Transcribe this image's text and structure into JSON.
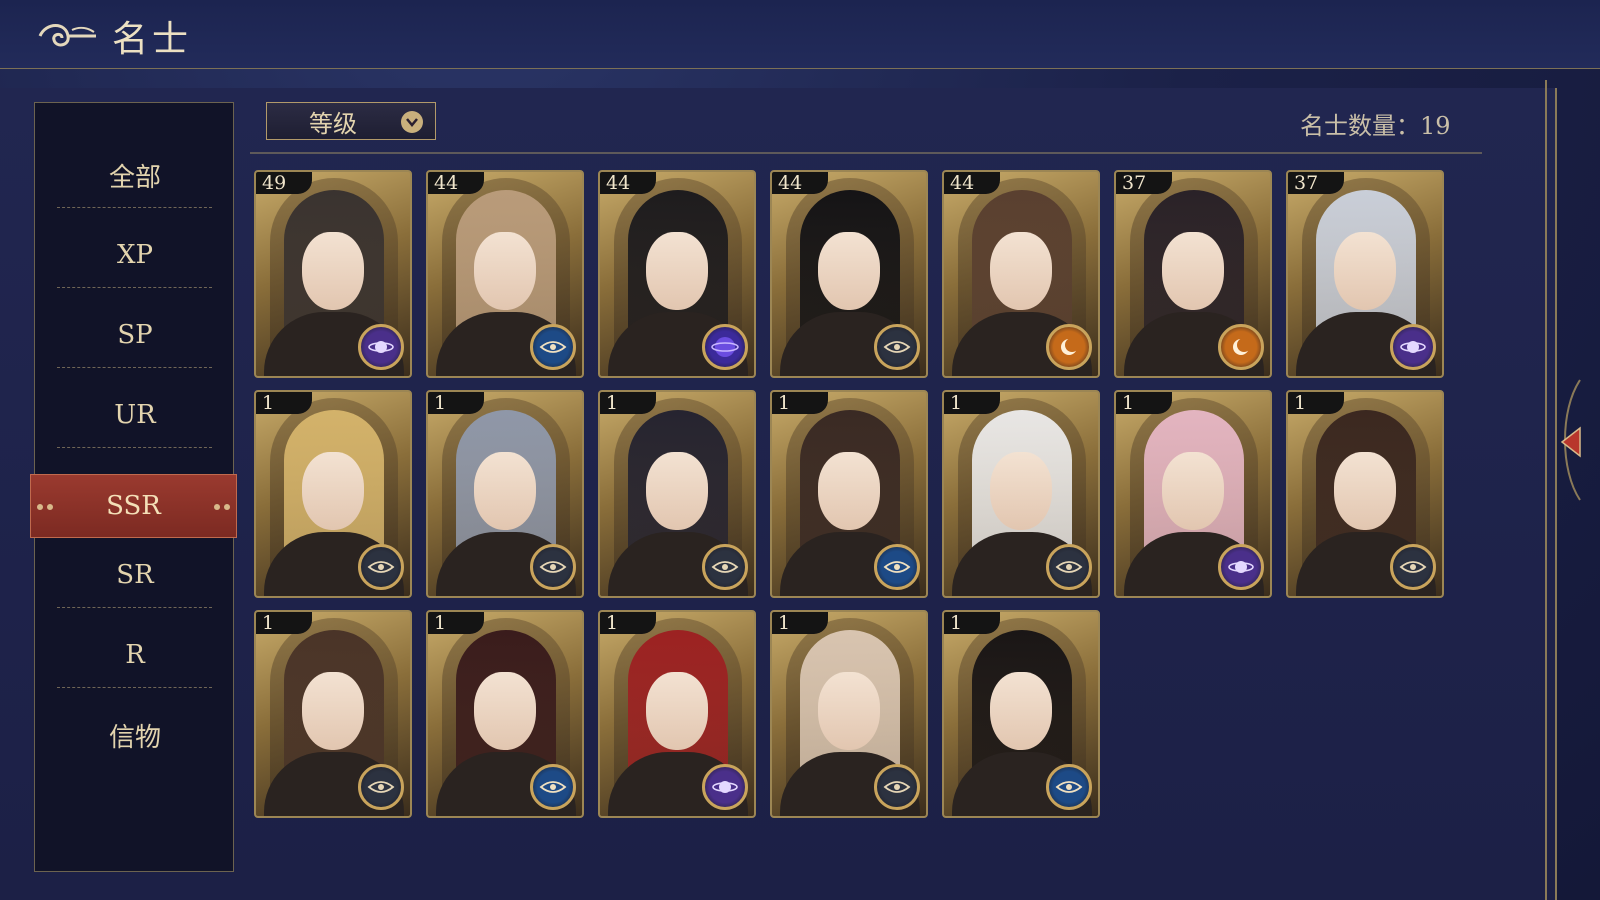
{
  "header": {
    "title": "名士"
  },
  "sidebar": {
    "items": [
      {
        "label": "全部"
      },
      {
        "label": "XP"
      },
      {
        "label": "SP"
      },
      {
        "label": "UR"
      },
      {
        "label": "SSR"
      },
      {
        "label": "SR"
      },
      {
        "label": "R"
      },
      {
        "label": "信物"
      }
    ],
    "active": "SSR"
  },
  "toolbar": {
    "sort_label": "等级",
    "count_label": "名士数量：",
    "count_value": "19"
  },
  "cards": [
    {
      "level": "49",
      "badge": "purple-planet",
      "hair": "#3a3330"
    },
    {
      "level": "44",
      "badge": "blue-eye",
      "hair": "#b99b7a"
    },
    {
      "level": "44",
      "badge": "blue-orb",
      "hair": "#1e1c1e"
    },
    {
      "level": "44",
      "badge": "dark-eye",
      "hair": "#151416"
    },
    {
      "level": "44",
      "badge": "orange-moon",
      "hair": "#5a4030"
    },
    {
      "level": "37",
      "badge": "orange-moon",
      "hair": "#2a2228"
    },
    {
      "level": "37",
      "badge": "purple-planet",
      "hair": "#c9ced8"
    },
    {
      "level": "1",
      "badge": "dark-eye",
      "hair": "#d3b26a"
    },
    {
      "level": "1",
      "badge": "dark-eye",
      "hair": "#8f97a8"
    },
    {
      "level": "1",
      "badge": "dark-eye",
      "hair": "#262430"
    },
    {
      "level": "1",
      "badge": "blue-eye",
      "hair": "#3a2a24"
    },
    {
      "level": "1",
      "badge": "dark-eye",
      "hair": "#e8e6e4"
    },
    {
      "level": "1",
      "badge": "purple-planet",
      "hair": "#e3b4c0"
    },
    {
      "level": "1",
      "badge": "dark-eye",
      "hair": "#3b2820"
    },
    {
      "level": "1",
      "badge": "dark-eye",
      "hair": "#4a3428"
    },
    {
      "level": "1",
      "badge": "blue-eye",
      "hair": "#3a1c1c"
    },
    {
      "level": "1",
      "badge": "purple-planet",
      "hair": "#9c2222"
    },
    {
      "level": "1",
      "badge": "dark-eye",
      "hair": "#d8c4b0"
    },
    {
      "level": "1",
      "badge": "blue-eye",
      "hair": "#1a1616"
    }
  ],
  "colors": {
    "background": "#1b2148",
    "panel": "#212650",
    "accent_red": "#8a3128",
    "gold": "#c9a45c",
    "text": "#e3d4ae"
  }
}
